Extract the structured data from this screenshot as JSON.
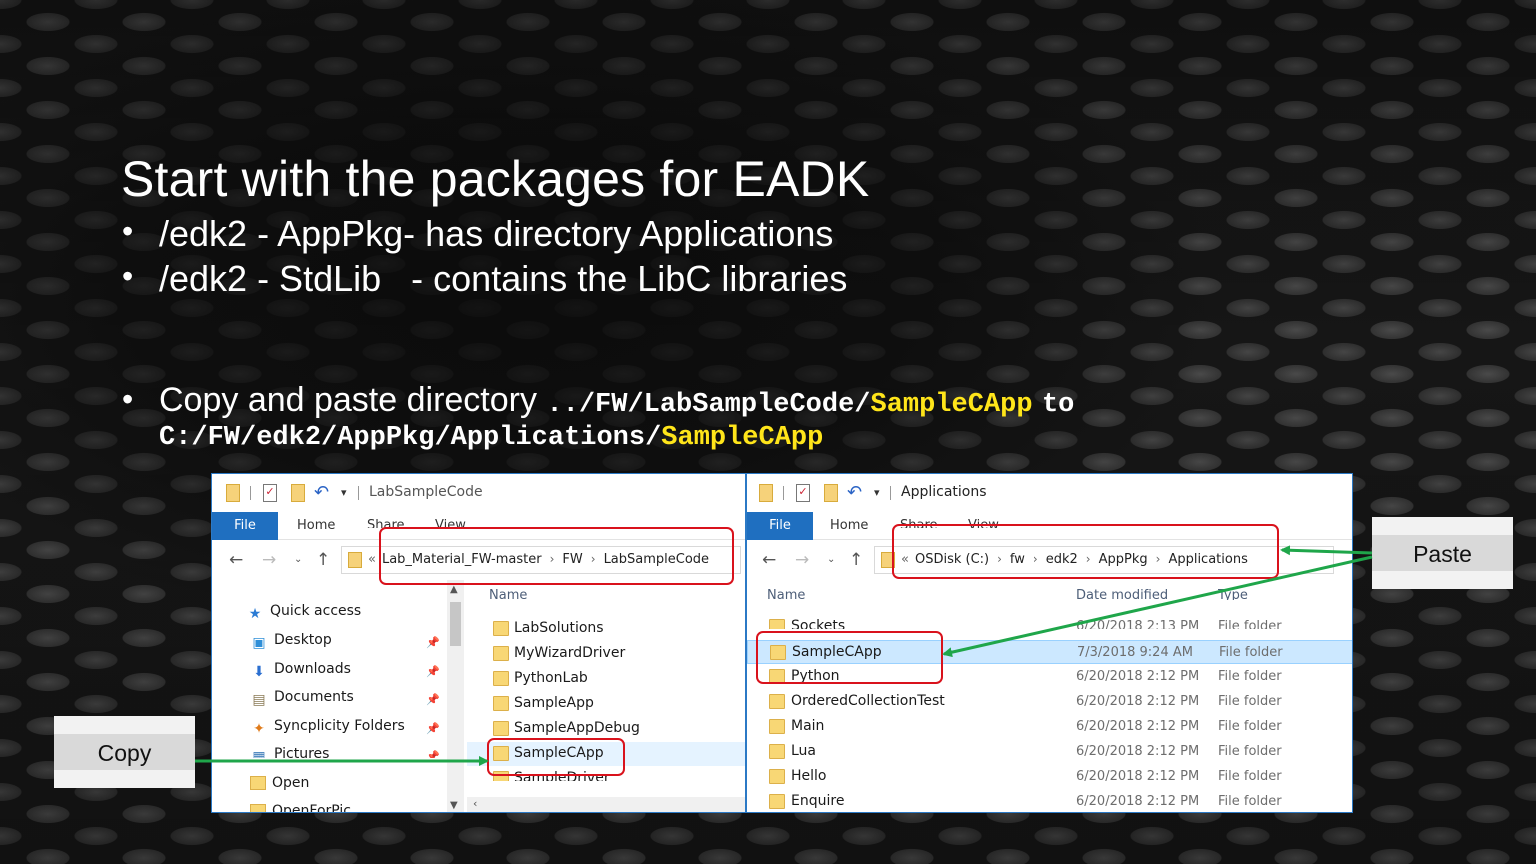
{
  "slide": {
    "title": "Start with the packages for EADK",
    "bullets": [
      {
        "dot": "•",
        "parts": [
          "/edk2  - AppPkg",
          "- has directory Applications"
        ]
      },
      {
        "dot": "•",
        "parts": [
          "/edk2 -  StdLib",
          "- contains the LibC libraries"
        ]
      }
    ],
    "copy_bullet": {
      "dot": "•",
      "prefix": "Copy and paste directory",
      "src_path": "../FW/LabSampleCode/",
      "src_name": "SampleCApp",
      "to": "to",
      "dst_path": "C:/FW/edk2/AppPkg/Applications/",
      "dst_name": "SampleCApp"
    },
    "colors": {
      "highlight": "#ffe51a",
      "callout": "#d9121c",
      "arrow": "#1fa64a"
    }
  },
  "left_window": {
    "title": "LabSampleCode",
    "ribbon": {
      "file": "File",
      "home": "Home",
      "share": "Share",
      "view": "View"
    },
    "breadcrumb": {
      "lead": "«",
      "items": [
        "Lab_Material_FW-master",
        "FW",
        "LabSampleCode"
      ]
    },
    "nav": {
      "back_icon": "back-arrow-icon",
      "forward_icon": "forward-arrow-icon",
      "up_icon": "up-arrow-icon",
      "back": "←",
      "forward": "→",
      "caret": "⌄",
      "up": "↑"
    },
    "nav_items": [
      {
        "label": "Quick access",
        "icon": "★",
        "icon_name": "quick-access-icon",
        "pinned": false
      },
      {
        "label": "Desktop",
        "icon": "▣",
        "icon_name": "desktop-icon",
        "pinned": true
      },
      {
        "label": "Downloads",
        "icon": "⬇",
        "icon_name": "downloads-icon",
        "pinned": true
      },
      {
        "label": "Documents",
        "icon": "▤",
        "icon_name": "documents-icon",
        "pinned": true
      },
      {
        "label": "Syncplicity Folders",
        "icon": "✦",
        "icon_name": "syncplicity-icon",
        "pinned": true
      },
      {
        "label": "Pictures",
        "icon": "▦",
        "icon_name": "pictures-icon",
        "pinned": true
      },
      {
        "label": "Open",
        "icon": "",
        "icon_name": "folder-icon",
        "pinned": false
      },
      {
        "label": "OpenForPic",
        "icon": "",
        "icon_name": "folder-icon",
        "pinned": false
      }
    ],
    "pin_glyph": "📌",
    "column_name": "Name",
    "files": [
      "LabSolutions",
      "MyWizardDriver",
      "PythonLab",
      "SampleApp",
      "SampleAppDebug",
      "SampleCApp",
      "SampleDriver"
    ],
    "selected_file": "SampleCApp"
  },
  "right_window": {
    "title": "Applications",
    "ribbon": {
      "file": "File",
      "home": "Home",
      "share": "Share",
      "view": "View"
    },
    "breadcrumb": {
      "lead": "«",
      "items": [
        "OSDisk (C:)",
        "fw",
        "edk2",
        "AppPkg",
        "Applications"
      ]
    },
    "columns": {
      "name": "Name",
      "date": "Date modified",
      "type": "Type"
    },
    "files": [
      {
        "name": "Sockets",
        "date": "6/20/2018 2:13 PM",
        "type": "File folder"
      },
      {
        "name": "SampleCApp",
        "date": "7/3/2018 9:24 AM",
        "type": "File folder"
      },
      {
        "name": "Python",
        "date": "6/20/2018 2:12 PM",
        "type": "File folder"
      },
      {
        "name": "OrderedCollectionTest",
        "date": "6/20/2018 2:12 PM",
        "type": "File folder"
      },
      {
        "name": "Main",
        "date": "6/20/2018 2:12 PM",
        "type": "File folder"
      },
      {
        "name": "Lua",
        "date": "6/20/2018 2:12 PM",
        "type": "File folder"
      },
      {
        "name": "Hello",
        "date": "6/20/2018 2:12 PM",
        "type": "File folder"
      },
      {
        "name": "Enquire",
        "date": "6/20/2018 2:12 PM",
        "type": "File folder"
      }
    ],
    "selected_file": "SampleCApp"
  },
  "labels": {
    "copy": "Copy",
    "paste": "Paste"
  }
}
